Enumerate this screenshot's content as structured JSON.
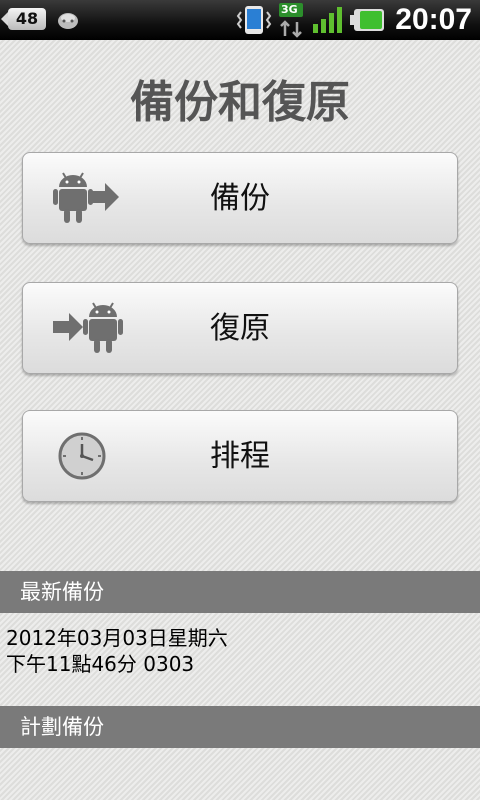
{
  "status_bar": {
    "notification_count": "48",
    "network_label": "3G",
    "time": "20:07"
  },
  "title": "備份和復原",
  "buttons": {
    "backup": "備份",
    "restore": "復原",
    "schedule": "排程"
  },
  "latest_backup": {
    "header": "最新備份",
    "date": "2012年03月03日星期六",
    "detail": "下午11點46分 0303"
  },
  "scheduled_backup": {
    "header": "計劃備份"
  },
  "colors": {
    "section_header": "#7a7a7a",
    "title": "#555555",
    "icon_gray": "#6f6f6f",
    "battery_green": "#3fbf2f",
    "signal_green": "#5fbf2f"
  }
}
